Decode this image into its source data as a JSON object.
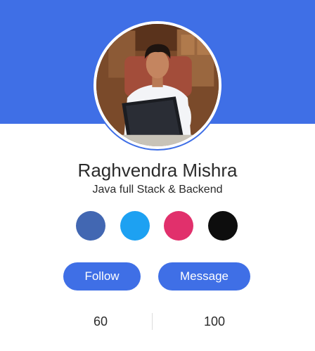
{
  "profile": {
    "name": "Raghvendra Mishra",
    "role": "Java full Stack & Backend"
  },
  "socials": [
    {
      "icon": "facebook-icon",
      "color": "#4267b2"
    },
    {
      "icon": "twitter-icon",
      "color": "#1da1f2"
    },
    {
      "icon": "instagram-icon",
      "color": "#e1306c"
    },
    {
      "icon": "github-icon",
      "color": "#0d0d0d"
    }
  ],
  "actions": {
    "follow_label": "Follow",
    "message_label": "Message"
  },
  "stats": {
    "left_value": "60",
    "right_value": "100"
  },
  "theme": {
    "accent": "#3f6fe6",
    "text": "#2b2b2b"
  }
}
